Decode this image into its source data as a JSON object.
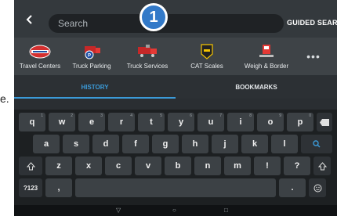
{
  "page": {
    "stray_text": "e."
  },
  "topbar": {
    "search_placeholder": "Search",
    "guided_search_label": "GUIDED SEARCH",
    "step_badge": "1"
  },
  "categories": [
    {
      "label": "Travel Centers",
      "icon": "travel-centers-logo-icon"
    },
    {
      "label": "Truck Parking",
      "icon": "truck-parking-icon"
    },
    {
      "label": "Truck Services",
      "icon": "truck-services-icon"
    },
    {
      "label": "CAT Scales",
      "icon": "cat-scales-icon"
    },
    {
      "label": "Weigh & Border",
      "icon": "weigh-border-icon"
    },
    {
      "label": "•••",
      "icon": "more-icon"
    }
  ],
  "tabs": [
    {
      "label": "HISTORY",
      "active": true
    },
    {
      "label": "BOOKMARKS",
      "active": false
    }
  ],
  "keyboard": {
    "row1": [
      "q",
      "w",
      "e",
      "r",
      "t",
      "y",
      "u",
      "i",
      "o",
      "p"
    ],
    "row1_hints": [
      "1",
      "2",
      "3",
      "4",
      "5",
      "6",
      "7",
      "8",
      "9",
      "0"
    ],
    "row2": [
      "a",
      "s",
      "d",
      "f",
      "g",
      "h",
      "j",
      "k",
      "l"
    ],
    "row3": [
      "z",
      "x",
      "c",
      "v",
      "b",
      "n",
      "m",
      "!",
      "?"
    ],
    "mode_key": "?123",
    "comma_key": ",",
    "period_key": "."
  },
  "colors": {
    "accent": "#3b9ad8",
    "badge": "#3279c8",
    "background": "#2b2f33"
  }
}
